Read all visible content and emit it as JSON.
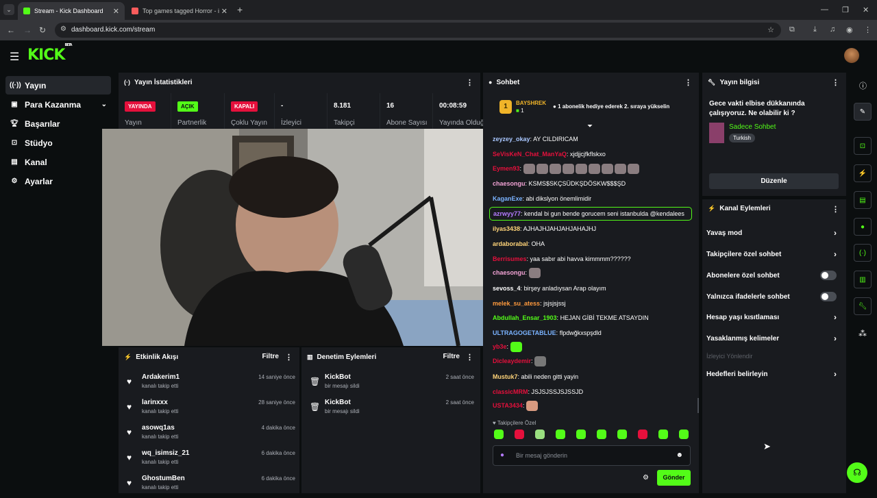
{
  "browser": {
    "tabs": [
      {
        "label": "Stream - Kick Dashboard",
        "active": true
      },
      {
        "label": "Top games tagged Horror - itch",
        "active": false
      }
    ],
    "url": "dashboard.kick.com/stream"
  },
  "brand": {
    "logo": "KICK",
    "logo_sup": "BETA",
    "accent": "#53fc18"
  },
  "sidebar": {
    "items": [
      {
        "label": "Yayın",
        "icon": "broadcast-icon",
        "active": true
      },
      {
        "label": "Para Kazanma",
        "icon": "money-icon"
      },
      {
        "label": "Başarılar",
        "icon": "trophy-icon"
      },
      {
        "label": "Stüdyo",
        "icon": "studio-icon"
      },
      {
        "label": "Kanal",
        "icon": "channel-icon"
      },
      {
        "label": "Ayarlar",
        "icon": "gear-icon"
      }
    ]
  },
  "stats": {
    "title": "Yayın İstatistikleri",
    "items": [
      {
        "badge": "YAYINDA",
        "label": "Yayın",
        "color": "#e5103c"
      },
      {
        "badge": "AÇIK",
        "label": "Partnerlik",
        "color": "#53fc18"
      },
      {
        "badge": "KAPALI",
        "label": "Çoklu Yayın",
        "color": "#e5103c"
      },
      {
        "value": "-",
        "label": "İzleyici"
      },
      {
        "value": "8.181",
        "label": "Takipçi"
      },
      {
        "value": "16",
        "label": "Abone Sayısı"
      },
      {
        "value": "00:08:59",
        "label": "Yayında Olduğu"
      }
    ]
  },
  "activity": {
    "title": "Etkinlik Akışı",
    "filter": "Filtre",
    "rows": [
      {
        "name": "Ardakerim1",
        "sub": "kanalı takip etti",
        "time": "14 saniye önce"
      },
      {
        "name": "larinxxx",
        "sub": "kanalı takip etti",
        "time": "28 saniye önce"
      },
      {
        "name": "asowq1as",
        "sub": "kanalı takip etti",
        "time": "4 dakika önce"
      },
      {
        "name": "wq_isimsiz_21",
        "sub": "kanalı takip etti",
        "time": "6 dakika önce"
      },
      {
        "name": "GhostumBen",
        "sub": "kanalı takip etti",
        "time": "6 dakika önce"
      }
    ]
  },
  "moderation": {
    "title": "Denetim Eylemleri",
    "filter": "Filtre",
    "rows": [
      {
        "name": "KickBot",
        "sub": "bir mesajı sildi",
        "time": "2 saat önce"
      },
      {
        "name": "KickBot",
        "sub": "bir mesajı sildi",
        "time": "2 saat önce"
      }
    ]
  },
  "chat": {
    "title": "Sohbet",
    "pinned_user": "BAYSHREK",
    "pinned_count": "1",
    "pinned_text": "1 abonelik hediye ederek 2. sıraya yükselin",
    "messages": [
      {
        "user": "zeyzey_okay",
        "text": "AY CILDIRICAM",
        "color": "#a9c7ff"
      },
      {
        "user": "SeVisKeN_Chat_ManYaQ",
        "text": "xjdjjcjfkflskxo",
        "color": "#e5103c"
      },
      {
        "user": "Eymen93",
        "text": "",
        "color": "#e5103c",
        "emotes": 9
      },
      {
        "user": "chaesongu",
        "text": "KSMS$SKÇSÜDKŞDÖSKW$$$ŞD",
        "color": "#f2a3d5"
      },
      {
        "user": "KaganExe",
        "text": "abi dikslyon önemlimidir",
        "color": "#7ab3ff"
      },
      {
        "user": "azrwyy77",
        "text": "kendal bi gun bende gorucem seni istanbulda @kendalees",
        "color": "#b57bff"
      },
      {
        "user": "ilyas3438",
        "text": "AJHAJHJAHJAHJAHAJHJ",
        "color": "#ffd479"
      },
      {
        "user": "ardaborabal",
        "text": "OHA",
        "color": "#ffd479"
      },
      {
        "user": "Berrisumes",
        "text": "yaa sabır abi havva kimmmm??????",
        "color": "#e5103c"
      },
      {
        "user": "chaesongu",
        "text": "",
        "color": "#f2a3d5",
        "emotes": 1
      },
      {
        "user": "sevoss_4",
        "text": "birşey anladıysan Arap olayım",
        "color": "#ffffff"
      },
      {
        "user": "melek_su_atess",
        "text": "jsjsjsjssj",
        "color": "#ff9a3d"
      },
      {
        "user": "Abdullah_Ensar_1903",
        "text": "HEJAN GİBİ TEKME ATSAYDIN",
        "color": "#53fc18"
      },
      {
        "user": "ULTRAGOGETABLUE",
        "text": "flpdwğkxspşdld",
        "color": "#7ab3ff"
      },
      {
        "user": "yb3e",
        "text": "",
        "color": "#e5103c",
        "emotes": 1
      },
      {
        "user": "Dicleaydemir",
        "text": "",
        "color": "#e5103c",
        "emotes": 1
      },
      {
        "user": "Mustuk7",
        "text": "abili neden gitti yayin",
        "color": "#ffd479"
      },
      {
        "user": "classicMRM",
        "text": "JSJSJSSJSJSSJD",
        "color": "#e5103c"
      },
      {
        "user": "USTA3434",
        "text": "",
        "color": "#e5103c",
        "emotes": 1
      }
    ],
    "followers_only": "Takipçilere Özel",
    "placeholder": "Bir mesaj gönderin",
    "send": "Gönder"
  },
  "stream_info": {
    "title": "Yayın bilgisi",
    "stream_title": "Gece vakti elbise dükkanında çalışıyoruz. Ne olabilir ki ?",
    "category": "Sadece Sohbet",
    "tag": "Turkish",
    "edit": "Düzenle"
  },
  "channel_actions": {
    "title": "Kanal Eylemleri",
    "items": [
      {
        "label": "Yavaş mod",
        "kind": "chevron"
      },
      {
        "label": "Takipçilere özel sohbet",
        "kind": "chevron"
      },
      {
        "label": "Abonelere özel sohbet",
        "kind": "toggle"
      },
      {
        "label": "Yalnızca ifadelerle sohbet",
        "kind": "toggle"
      },
      {
        "label": "Hesap yaşı kısıtlaması",
        "kind": "chevron"
      },
      {
        "label": "Yasaklanmış kelimeler",
        "kind": "chevron"
      },
      {
        "label": "İzleyici Yönlendir",
        "kind": "disabled"
      },
      {
        "label": "Hedefleri belirleyin",
        "kind": "chevron"
      }
    ]
  }
}
